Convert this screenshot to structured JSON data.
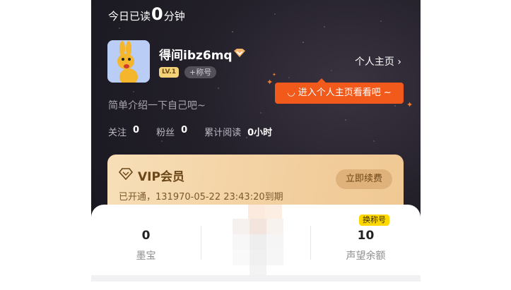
{
  "header": {
    "read_prefix": "今日已读",
    "read_value": "0",
    "read_unit": "分钟"
  },
  "profile": {
    "username": "得间ibz6mq",
    "level": "LV.1",
    "title_badge": "+称号",
    "profile_link": "个人主页",
    "tooltip": "进入个人主页看看吧 ~",
    "bio": "简单介绍一下自己吧~"
  },
  "stats": [
    {
      "label": "关注",
      "value": "0"
    },
    {
      "label": "粉丝",
      "value": "0"
    },
    {
      "label": "累计阅读",
      "value": "0小时"
    }
  ],
  "vip": {
    "title": "VIP会员",
    "status": "已开通，131970-05-22 23:43:20到期",
    "renew_button": "立即续费"
  },
  "assets": [
    {
      "value": "0",
      "label": "墨宝"
    },
    {
      "value": "",
      "label": ""
    },
    {
      "value": "10",
      "label": "声望余额"
    }
  ],
  "swap_badge": "换称号",
  "colors": {
    "tooltip": "#f25a1c",
    "vip_gold": "#f2cf9f",
    "badge_yellow": "#ffd800"
  },
  "icons": [
    "chevron-right-icon",
    "smile-icon",
    "sparkle-icon",
    "vip-diamond-icon",
    "verified-v-icon"
  ]
}
